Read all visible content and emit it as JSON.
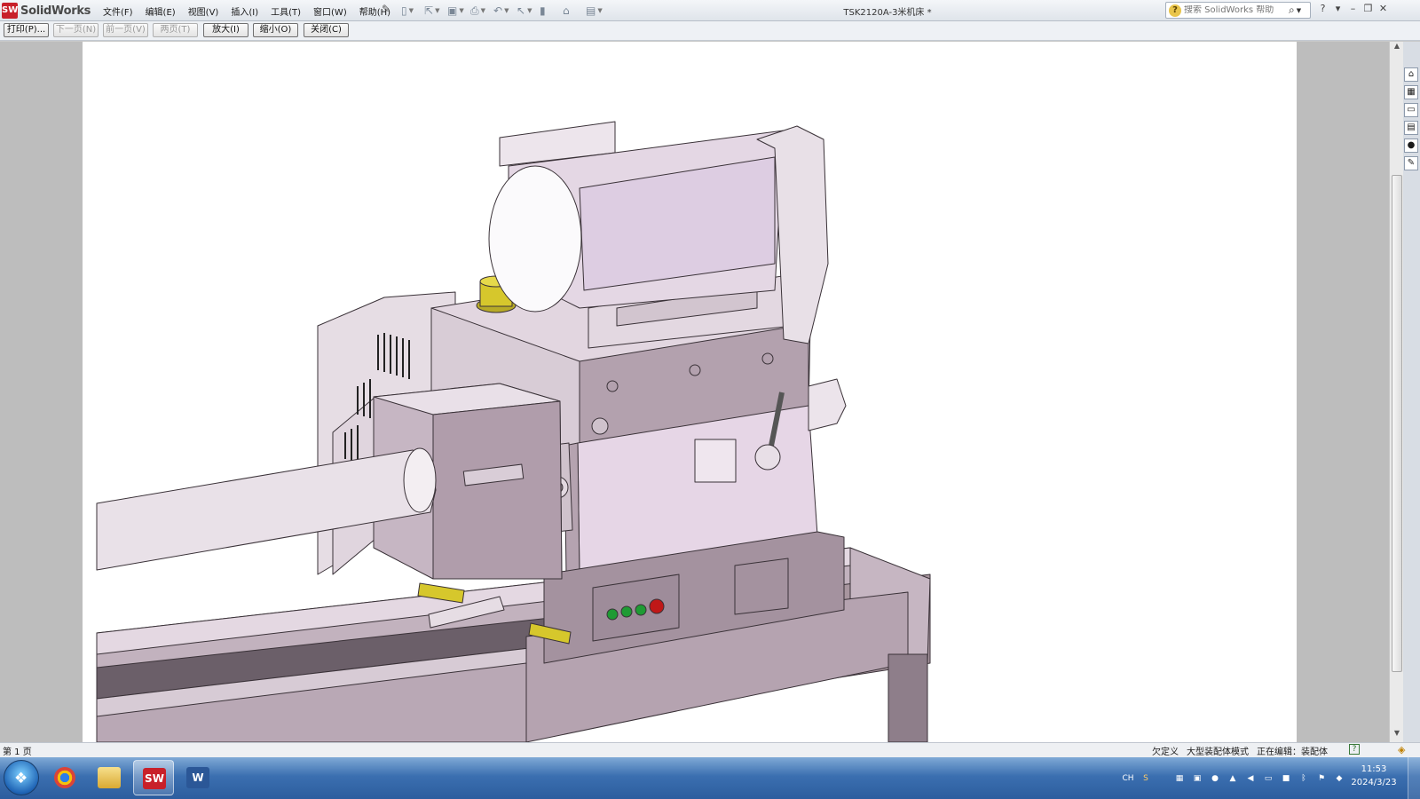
{
  "app": {
    "logo_badge": "SW",
    "logo_text": "SolidWorks",
    "document_title": "TSK2120A-3米机床 *"
  },
  "menus": [
    {
      "label": "文件(F)"
    },
    {
      "label": "编辑(E)"
    },
    {
      "label": "视图(V)"
    },
    {
      "label": "插入(I)"
    },
    {
      "label": "工具(T)"
    },
    {
      "label": "窗口(W)"
    },
    {
      "label": "帮助(H)"
    }
  ],
  "search": {
    "placeholder": "搜索 SolidWorks 帮助"
  },
  "print_preview": {
    "buttons": [
      {
        "label": "打印(P)...",
        "enabled": true
      },
      {
        "label": "下一页(N)",
        "enabled": false
      },
      {
        "label": "前一页(V)",
        "enabled": false
      },
      {
        "label": "两页(T)",
        "enabled": false
      },
      {
        "label": "放大(I)",
        "enabled": true
      },
      {
        "label": "缩小(O)",
        "enabled": true
      },
      {
        "label": "关闭(C)",
        "enabled": true
      }
    ]
  },
  "status": {
    "page": "第 1 页",
    "definition": "欠定义",
    "mode": "大型装配体模式",
    "editing": "正在编辑：装配体",
    "help_icon": "?"
  },
  "taskbar": {
    "items": [
      {
        "name": "chrome",
        "active": false
      },
      {
        "name": "explorer",
        "active": false
      },
      {
        "name": "solidworks",
        "active": true
      },
      {
        "name": "word",
        "active": false
      }
    ],
    "tray_lang": "CH",
    "time": "11:53",
    "date": "2024/3/23"
  },
  "colors": {
    "machine_body": "#b9a6b4",
    "machine_light": "#e8dbe6",
    "machine_side": "#9c8b98",
    "accent_yellow": "#d6c72c",
    "button_green": "#1f9b34",
    "button_red": "#c01818"
  }
}
